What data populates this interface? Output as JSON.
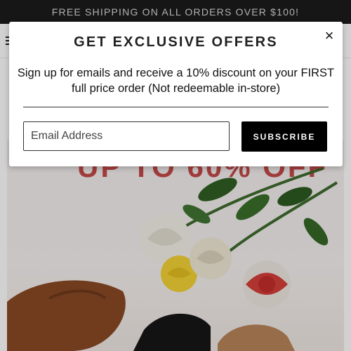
{
  "promo_bar": {
    "text": "FREE SHIPPING ON ALL ORDERS OVER $100!"
  },
  "hero": {
    "headline": "UP TO 60% OFF"
  },
  "modal": {
    "title": "GET EXCLUSIVE OFFERS",
    "close_icon": "×",
    "copy": "Sign up for emails and receive a 10% discount on your FIRST full price order (Not redeemable in-store)",
    "email_placeholder": "Email Address",
    "subscribe_label": "SUBSCRIBE"
  }
}
